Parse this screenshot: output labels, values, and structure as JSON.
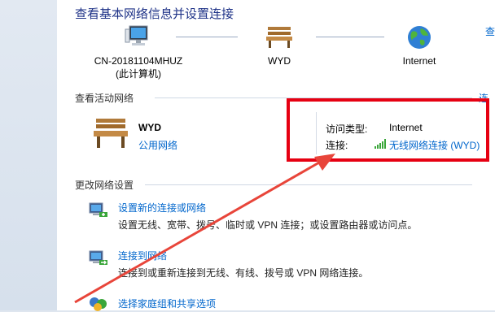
{
  "header": {
    "title": "查看基本网络信息并设置连接"
  },
  "map": {
    "computer": {
      "name": "CN-20181104MHUZ",
      "sub": "(此计算机)"
    },
    "network": {
      "name": "WYD"
    },
    "internet": {
      "name": "Internet"
    },
    "full_map_link": "查"
  },
  "active": {
    "label": "查看活动网络",
    "right_link": "连",
    "network_name": "WYD",
    "network_type": "公用网络",
    "access_type_label": "访问类型:",
    "access_type_value": "Internet",
    "connection_label": "连接:",
    "connection_value": "无线网络连接 (WYD)"
  },
  "settings": {
    "label": "更改网络设置",
    "tasks": [
      {
        "title": "设置新的连接或网络",
        "desc": "设置无线、宽带、拨号、临时或 VPN 连接；或设置路由器或访问点。"
      },
      {
        "title": "连接到网络",
        "desc": "连接到或重新连接到无线、有线、拨号或 VPN 网络连接。"
      },
      {
        "title": "选择家庭组和共享选项",
        "desc": ""
      }
    ]
  },
  "colors": {
    "accent": "#0066cc",
    "title": "#1e3287",
    "highlight": "#e60012"
  },
  "icons": [
    "computer-icon",
    "bench-icon",
    "globe-icon",
    "signal-icon",
    "connect-icon",
    "homegroup-icon"
  ]
}
